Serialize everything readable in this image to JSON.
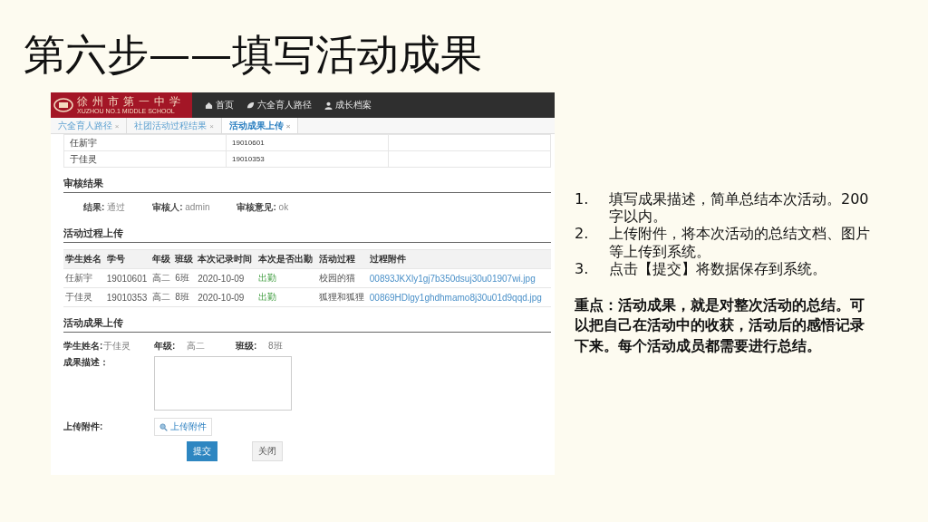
{
  "slide_title": "第六步——填写活动成果",
  "app": {
    "logo": {
      "name": "徐州市第一中学",
      "subtitle": "XUZHOU NO.1 MIDDLE SCHOOL"
    },
    "nav": [
      {
        "label": "首页"
      },
      {
        "label": "六全育人路径"
      },
      {
        "label": "成长档案"
      }
    ],
    "tabs": [
      {
        "label": "六全育人路径",
        "close": "×",
        "selected": false
      },
      {
        "label": "社团活动过程结果",
        "close": "×",
        "selected": false
      },
      {
        "label": "活动成果上传",
        "close": "×",
        "selected": true
      }
    ],
    "member_rows": [
      {
        "name": "任新宇",
        "id": "19010601"
      },
      {
        "name": "于佳灵",
        "id": "19010353"
      }
    ],
    "review": {
      "title": "审核结果",
      "fields": [
        {
          "label": "结果:",
          "value": "通过"
        },
        {
          "label": "审核人:",
          "value": "admin"
        },
        {
          "label": "审核意见:",
          "value": "ok"
        }
      ]
    },
    "process": {
      "title": "活动过程上传",
      "columns": [
        "学生姓名",
        "学号",
        "年级",
        "班级",
        "本次记录时间",
        "本次是否出勤",
        "活动过程",
        "过程附件"
      ],
      "rows": [
        {
          "name": "任新宇",
          "id": "19010601",
          "grade": "高二",
          "class": "6班",
          "time": "2020-10-09",
          "attendance": "出勤",
          "activity": "校园的猫",
          "attachment": "00893JKXly1gj7b350dsuj30u01907wi.jpg"
        },
        {
          "name": "于佳灵",
          "id": "19010353",
          "grade": "高二",
          "class": "8班",
          "time": "2020-10-09",
          "attendance": "出勤",
          "activity": "狐狸和狐狸",
          "attachment": "00869HDlgy1ghdhmamo8j30u01d9qqd.jpg"
        }
      ]
    },
    "result_form": {
      "title": "活动成果上传",
      "info": [
        {
          "label": "学生姓名:",
          "value": "于佳灵"
        },
        {
          "label": "年级:",
          "value": "高二"
        },
        {
          "label": "班级:",
          "value": "8班"
        }
      ],
      "description_label": "成果描述：",
      "attachment_label": "上传附件:",
      "upload_button": "上传附件",
      "buttons": [
        {
          "label": "提交",
          "kind": "primary"
        },
        {
          "label": "关闭",
          "kind": "default"
        }
      ]
    }
  },
  "steps": [
    {
      "number": "1.",
      "text": "填写成果描述，简单总结本次活动。200字以内。"
    },
    {
      "number": "2.",
      "text": "上传附件，将本次活动的总结文档、图片等上传到系统。"
    },
    {
      "number": "3.",
      "text": "点击【提交】将数据保存到系统。"
    }
  ],
  "note": "重点：活动成果，就是对整次活动的总结。可以把自己在活动中的收获，活动后的感悟记录下来。每个活动成员都需要进行总结。"
}
